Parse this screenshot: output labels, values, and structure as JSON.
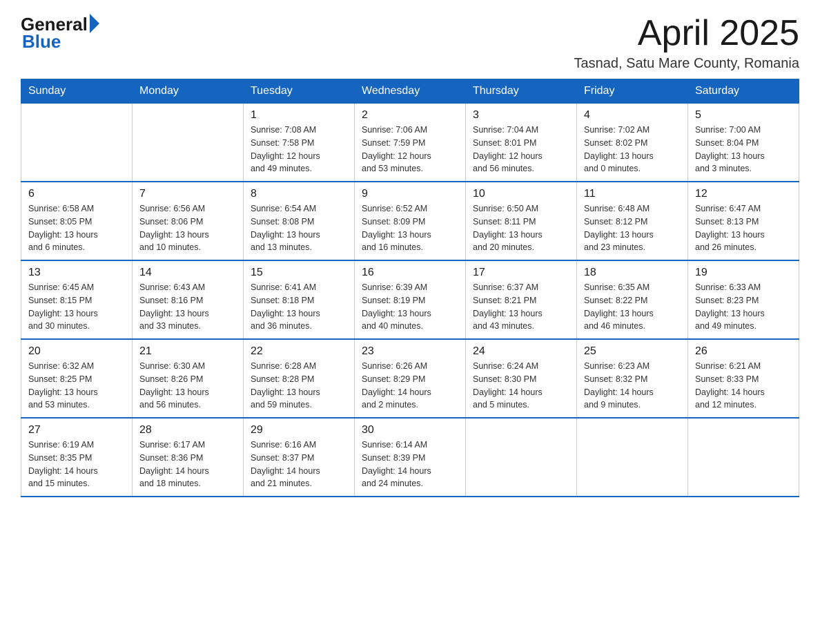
{
  "header": {
    "logo_general": "General",
    "logo_blue": "Blue",
    "month_title": "April 2025",
    "location": "Tasnad, Satu Mare County, Romania"
  },
  "days_of_week": [
    "Sunday",
    "Monday",
    "Tuesday",
    "Wednesday",
    "Thursday",
    "Friday",
    "Saturday"
  ],
  "weeks": [
    [
      {
        "day": "",
        "info": ""
      },
      {
        "day": "",
        "info": ""
      },
      {
        "day": "1",
        "info": "Sunrise: 7:08 AM\nSunset: 7:58 PM\nDaylight: 12 hours\nand 49 minutes."
      },
      {
        "day": "2",
        "info": "Sunrise: 7:06 AM\nSunset: 7:59 PM\nDaylight: 12 hours\nand 53 minutes."
      },
      {
        "day": "3",
        "info": "Sunrise: 7:04 AM\nSunset: 8:01 PM\nDaylight: 12 hours\nand 56 minutes."
      },
      {
        "day": "4",
        "info": "Sunrise: 7:02 AM\nSunset: 8:02 PM\nDaylight: 13 hours\nand 0 minutes."
      },
      {
        "day": "5",
        "info": "Sunrise: 7:00 AM\nSunset: 8:04 PM\nDaylight: 13 hours\nand 3 minutes."
      }
    ],
    [
      {
        "day": "6",
        "info": "Sunrise: 6:58 AM\nSunset: 8:05 PM\nDaylight: 13 hours\nand 6 minutes."
      },
      {
        "day": "7",
        "info": "Sunrise: 6:56 AM\nSunset: 8:06 PM\nDaylight: 13 hours\nand 10 minutes."
      },
      {
        "day": "8",
        "info": "Sunrise: 6:54 AM\nSunset: 8:08 PM\nDaylight: 13 hours\nand 13 minutes."
      },
      {
        "day": "9",
        "info": "Sunrise: 6:52 AM\nSunset: 8:09 PM\nDaylight: 13 hours\nand 16 minutes."
      },
      {
        "day": "10",
        "info": "Sunrise: 6:50 AM\nSunset: 8:11 PM\nDaylight: 13 hours\nand 20 minutes."
      },
      {
        "day": "11",
        "info": "Sunrise: 6:48 AM\nSunset: 8:12 PM\nDaylight: 13 hours\nand 23 minutes."
      },
      {
        "day": "12",
        "info": "Sunrise: 6:47 AM\nSunset: 8:13 PM\nDaylight: 13 hours\nand 26 minutes."
      }
    ],
    [
      {
        "day": "13",
        "info": "Sunrise: 6:45 AM\nSunset: 8:15 PM\nDaylight: 13 hours\nand 30 minutes."
      },
      {
        "day": "14",
        "info": "Sunrise: 6:43 AM\nSunset: 8:16 PM\nDaylight: 13 hours\nand 33 minutes."
      },
      {
        "day": "15",
        "info": "Sunrise: 6:41 AM\nSunset: 8:18 PM\nDaylight: 13 hours\nand 36 minutes."
      },
      {
        "day": "16",
        "info": "Sunrise: 6:39 AM\nSunset: 8:19 PM\nDaylight: 13 hours\nand 40 minutes."
      },
      {
        "day": "17",
        "info": "Sunrise: 6:37 AM\nSunset: 8:21 PM\nDaylight: 13 hours\nand 43 minutes."
      },
      {
        "day": "18",
        "info": "Sunrise: 6:35 AM\nSunset: 8:22 PM\nDaylight: 13 hours\nand 46 minutes."
      },
      {
        "day": "19",
        "info": "Sunrise: 6:33 AM\nSunset: 8:23 PM\nDaylight: 13 hours\nand 49 minutes."
      }
    ],
    [
      {
        "day": "20",
        "info": "Sunrise: 6:32 AM\nSunset: 8:25 PM\nDaylight: 13 hours\nand 53 minutes."
      },
      {
        "day": "21",
        "info": "Sunrise: 6:30 AM\nSunset: 8:26 PM\nDaylight: 13 hours\nand 56 minutes."
      },
      {
        "day": "22",
        "info": "Sunrise: 6:28 AM\nSunset: 8:28 PM\nDaylight: 13 hours\nand 59 minutes."
      },
      {
        "day": "23",
        "info": "Sunrise: 6:26 AM\nSunset: 8:29 PM\nDaylight: 14 hours\nand 2 minutes."
      },
      {
        "day": "24",
        "info": "Sunrise: 6:24 AM\nSunset: 8:30 PM\nDaylight: 14 hours\nand 5 minutes."
      },
      {
        "day": "25",
        "info": "Sunrise: 6:23 AM\nSunset: 8:32 PM\nDaylight: 14 hours\nand 9 minutes."
      },
      {
        "day": "26",
        "info": "Sunrise: 6:21 AM\nSunset: 8:33 PM\nDaylight: 14 hours\nand 12 minutes."
      }
    ],
    [
      {
        "day": "27",
        "info": "Sunrise: 6:19 AM\nSunset: 8:35 PM\nDaylight: 14 hours\nand 15 minutes."
      },
      {
        "day": "28",
        "info": "Sunrise: 6:17 AM\nSunset: 8:36 PM\nDaylight: 14 hours\nand 18 minutes."
      },
      {
        "day": "29",
        "info": "Sunrise: 6:16 AM\nSunset: 8:37 PM\nDaylight: 14 hours\nand 21 minutes."
      },
      {
        "day": "30",
        "info": "Sunrise: 6:14 AM\nSunset: 8:39 PM\nDaylight: 14 hours\nand 24 minutes."
      },
      {
        "day": "",
        "info": ""
      },
      {
        "day": "",
        "info": ""
      },
      {
        "day": "",
        "info": ""
      }
    ]
  ]
}
